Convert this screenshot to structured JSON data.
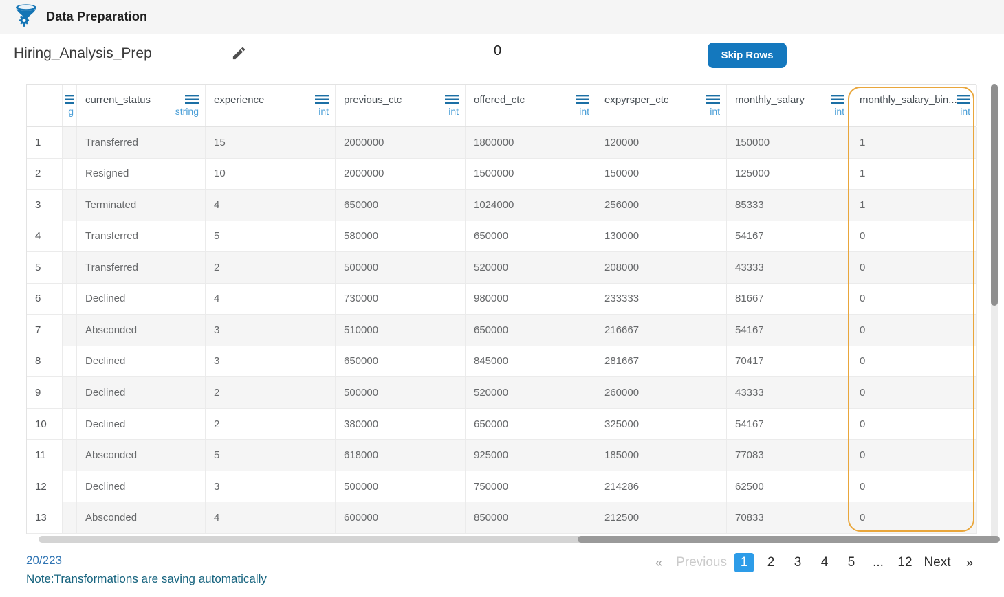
{
  "header": {
    "title": "Data Preparation"
  },
  "toolbar": {
    "dataset_name": "Hiring_Analysis_Prep",
    "skip_rows_value": "0",
    "skip_rows_label": "Skip Rows"
  },
  "table": {
    "cut_column": {
      "type_fragment": "g"
    },
    "columns": [
      {
        "name": "current_status",
        "type": "string",
        "highlighted": false
      },
      {
        "name": "experience",
        "type": "int",
        "highlighted": false
      },
      {
        "name": "previous_ctc",
        "type": "int",
        "highlighted": false
      },
      {
        "name": "offered_ctc",
        "type": "int",
        "highlighted": false
      },
      {
        "name": "expyrsper_ctc",
        "type": "int",
        "highlighted": false
      },
      {
        "name": "monthly_salary",
        "type": "int",
        "highlighted": false
      },
      {
        "name": "monthly_salary_bin...",
        "type": "int",
        "highlighted": true
      }
    ],
    "rows": [
      {
        "num": "1",
        "cells": [
          "Transferred",
          "15",
          "2000000",
          "1800000",
          "120000",
          "150000",
          "1"
        ]
      },
      {
        "num": "2",
        "cells": [
          "Resigned",
          "10",
          "2000000",
          "1500000",
          "150000",
          "125000",
          "1"
        ]
      },
      {
        "num": "3",
        "cells": [
          "Terminated",
          "4",
          "650000",
          "1024000",
          "256000",
          "85333",
          "1"
        ]
      },
      {
        "num": "4",
        "cells": [
          "Transferred",
          "5",
          "580000",
          "650000",
          "130000",
          "54167",
          "0"
        ]
      },
      {
        "num": "5",
        "cells": [
          "Transferred",
          "2",
          "500000",
          "520000",
          "208000",
          "43333",
          "0"
        ]
      },
      {
        "num": "6",
        "cells": [
          "Declined",
          "4",
          "730000",
          "980000",
          "233333",
          "81667",
          "0"
        ]
      },
      {
        "num": "7",
        "cells": [
          "Absconded",
          "3",
          "510000",
          "650000",
          "216667",
          "54167",
          "0"
        ]
      },
      {
        "num": "8",
        "cells": [
          "Declined",
          "3",
          "650000",
          "845000",
          "281667",
          "70417",
          "0"
        ]
      },
      {
        "num": "9",
        "cells": [
          "Declined",
          "2",
          "500000",
          "520000",
          "260000",
          "43333",
          "0"
        ]
      },
      {
        "num": "10",
        "cells": [
          "Declined",
          "2",
          "380000",
          "650000",
          "325000",
          "54167",
          "0"
        ]
      },
      {
        "num": "11",
        "cells": [
          "Absconded",
          "5",
          "618000",
          "925000",
          "185000",
          "77083",
          "0"
        ]
      },
      {
        "num": "12",
        "cells": [
          "Declined",
          "3",
          "500000",
          "750000",
          "214286",
          "62500",
          "0"
        ]
      },
      {
        "num": "13",
        "cells": [
          "Absconded",
          "4",
          "600000",
          "850000",
          "212500",
          "70833",
          "0"
        ]
      }
    ]
  },
  "footer": {
    "count": "20/223",
    "note": "Note:Transformations are saving automatically",
    "pagination": {
      "prev_arrow": "«",
      "prev_label": "Previous",
      "pages": [
        "1",
        "2",
        "3",
        "4",
        "5",
        "...",
        "12"
      ],
      "active_page": "1",
      "next_label": "Next",
      "next_arrow": "»"
    }
  },
  "colors": {
    "brand_blue": "#1575b5",
    "button_blue": "#1478be",
    "active_page_blue": "#2d9ce8",
    "highlight_orange": "#e9a63b",
    "column_type_blue": "#4da0d8",
    "column_menu_blue": "#1b6fa5",
    "count_blue": "#2f74b3",
    "note_teal": "#17647f"
  }
}
